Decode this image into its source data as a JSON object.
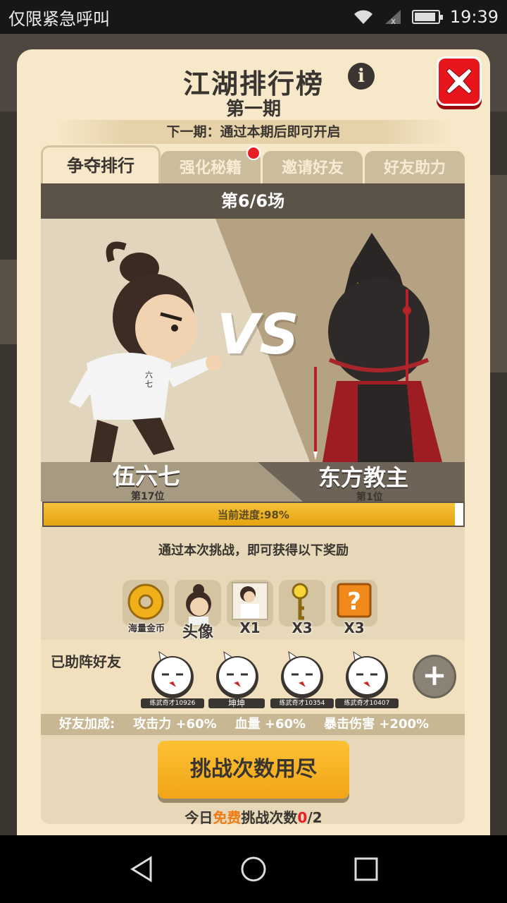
{
  "status_bar": {
    "carrier": "仅限紧急呼叫",
    "time": "19:39"
  },
  "header": {
    "title": "江湖排行榜",
    "period": "第一期",
    "info_icon": "info-icon",
    "close_icon": "close-icon"
  },
  "next_period": {
    "text": "下一期：通过本期后即可开启"
  },
  "tabs": [
    {
      "label": "争夺排行",
      "active": true
    },
    {
      "label": "强化秘籍",
      "active": false,
      "badge": true
    },
    {
      "label": "邀请好友",
      "active": false
    },
    {
      "label": "好友助力",
      "active": false
    }
  ],
  "battle": {
    "round": "第6/6场",
    "player": {
      "name": "伍六七",
      "rank": "第17位"
    },
    "opponent": {
      "name": "东方教主",
      "rank": "第1位"
    },
    "vs": "VS",
    "progress_label": "当前进度:98%",
    "progress_value": 0.98
  },
  "rewards": {
    "title": "通过本次挑战，即可获得以下奖励",
    "items": [
      {
        "icon": "gold-coin-icon",
        "label": "海量金币"
      },
      {
        "icon": "avatar-reward-icon",
        "label": "头像"
      },
      {
        "icon": "character-card-icon",
        "label": "X1"
      },
      {
        "icon": "key-icon",
        "label": "X3"
      },
      {
        "icon": "mystery-box-icon",
        "label": "X3"
      }
    ]
  },
  "helpers": {
    "title": "已助阵好友",
    "friends": [
      {
        "name": "练武奇才10926"
      },
      {
        "name": "坤坤"
      },
      {
        "name": "练武奇才10354"
      },
      {
        "name": "练武奇才10407"
      }
    ],
    "add_label": "+"
  },
  "bonus": {
    "label": "好友加成:",
    "items": [
      "攻击力 +60%",
      "血量 +60%",
      "暴击伤害 +200%"
    ]
  },
  "challenge": {
    "button_label": "挑战次数用尽",
    "free_prefix": "今日",
    "free_word": "免费",
    "free_mid": "挑战次数",
    "free_used": "0",
    "free_total": "/2"
  },
  "colors": {
    "accent": "#f2a51a",
    "close": "#e8151c",
    "panel": "#f7e8c9",
    "dark": "#3a3530"
  }
}
